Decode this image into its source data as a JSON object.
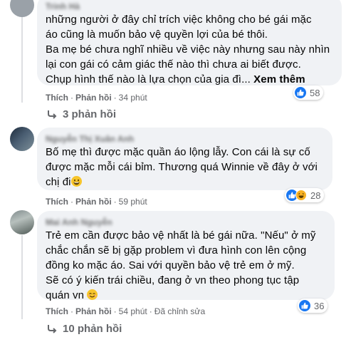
{
  "comments": [
    {
      "author": "Trinh Hà",
      "lines": [
        "những người ở đây chỉ trích việc không cho bé gái mặc",
        "áo cũng là muốn bảo vệ quyền lợi của bé thôi.",
        "Ba mẹ bé chưa nghĩ nhiều về việc này nhưng sau này nhìn",
        "lại con gái có cảm giác thế nào thì chưa ai biết được.",
        "Chụp hình thế nào là lựa chọn của gia đì..."
      ],
      "see_more": "Xem thêm",
      "like_label": "Thích",
      "reply_label": "Phản hồi",
      "time": "34 phút",
      "reaction_count": "58",
      "replies_label": "3 phản hồi"
    },
    {
      "author": "Nguyễn Thị Xuân Anh",
      "lines": [
        "Bố mẹ thì được mặc quần áo lộng lẫy. Con cái là sự cố",
        "được mặc mỗi cái bỉm. Thương quá Winnie về đây ở với",
        "chị đi"
      ],
      "like_label": "Thích",
      "reply_label": "Phản hồi",
      "time": "59 phút",
      "reaction_count": "28"
    },
    {
      "author": "Mai Anh Nguyễn",
      "lines": [
        "Trẻ em cần được bảo vệ nhất là bé gái nữa. \"Nếu\" ở mỹ",
        "chắc chắn sẽ bị gặp problem vì đưa hình con lên cộng",
        "đồng ko mặc áo. Sai với quyền bảo vệ trẻ em ở mỹ.",
        "Sẽ có ý kiến trái chiều, đang ở vn theo phong tục tập",
        "quán vn"
      ],
      "like_label": "Thích",
      "reply_label": "Phản hồi",
      "time": "54 phút",
      "edited": "Đã chỉnh sửa",
      "reaction_count": "36",
      "replies_label": "10 phản hồi"
    }
  ],
  "colors": {
    "bubble": "#f0f2f5",
    "meta": "#65676b",
    "like": "#1877f2",
    "haha": "#f7b125"
  }
}
